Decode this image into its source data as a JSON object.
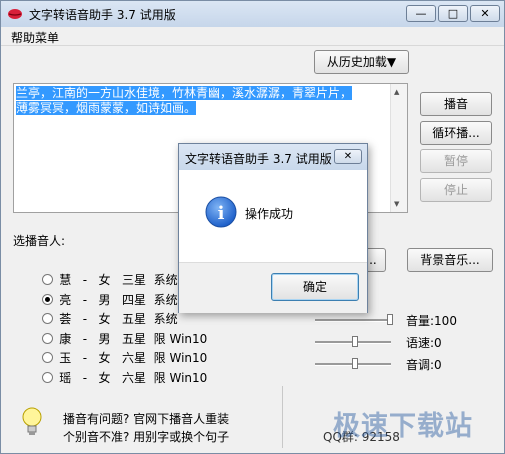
{
  "window": {
    "title": "文字转语音助手 3.7 试用版",
    "minimize": "—",
    "maximize": "□",
    "close": "✕"
  },
  "menu": {
    "help": "帮助菜单"
  },
  "history_button": "从历史加载▼",
  "text_content": {
    "line1": "兰亭，江南的一方山水佳境，竹林青幽，溪水潺潺，青翠片片，",
    "line2": "薄雾冥冥，烟雨蒙蒙，如诗如画。"
  },
  "controls": {
    "play": "播音",
    "loop": "循环播...",
    "pause": "暂停",
    "stop": "停止"
  },
  "voice_section": {
    "label": "选播音人:",
    "voices": [
      {
        "name": "慧",
        "sep": "-",
        "gender": "女",
        "stars": "三星",
        "limit": "系统",
        "selected": false
      },
      {
        "name": "亮",
        "sep": "-",
        "gender": "男",
        "stars": "四星",
        "limit": "系统",
        "selected": true
      },
      {
        "name": "荟",
        "sep": "-",
        "gender": "女",
        "stars": "五星",
        "limit": "系统",
        "selected": false
      },
      {
        "name": "康",
        "sep": "-",
        "gender": "男",
        "stars": "五星",
        "limit": "限 Win10",
        "selected": false
      },
      {
        "name": "玉",
        "sep": "-",
        "gender": "女",
        "stars": "六星",
        "limit": "限 Win10",
        "selected": false
      },
      {
        "name": "瑶",
        "sep": "-",
        "gender": "女",
        "stars": "六星",
        "limit": "限 Win10",
        "selected": false
      }
    ]
  },
  "partial_button": "...",
  "bg_music_button": "背景音乐...",
  "sliders": {
    "volume": {
      "label": "音量:100",
      "level": 1.0
    },
    "speed": {
      "label": "语速:0",
      "level": 0.5
    },
    "pitch": {
      "label": "音调:0",
      "level": 0.5
    }
  },
  "help_tip": {
    "line1": "播音有问题? 官网下播音人重装",
    "line2": "个别音不准? 用别字或换个句子"
  },
  "qq_text": "QQ群: 92158",
  "watermark": "极速下载站",
  "dialog": {
    "title": "文字转语音助手 3.7 试用版",
    "close": "✕",
    "message": "操作成功",
    "ok": "确定",
    "icon_glyph": "i"
  }
}
